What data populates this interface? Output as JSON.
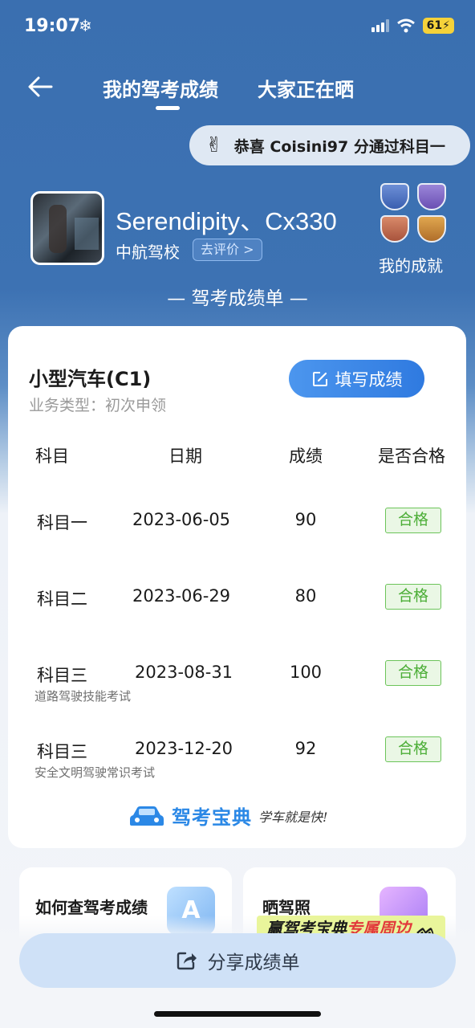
{
  "status_bar": {
    "time": "19:07",
    "battery": "61"
  },
  "nav": {
    "tab_mine": "我的驾考成绩",
    "tab_all": "大家正在晒"
  },
  "congrats": {
    "icon": "victory-hand-icon",
    "text": "恭喜 Coisini97 分通过科目一"
  },
  "profile": {
    "username": "Serendipity、Cx330",
    "school": "中航驾校",
    "review_label": "去评价 >",
    "achievements_label": "我的成就"
  },
  "sheet_title": "— 驾考成绩单 —",
  "card": {
    "vehicle": "小型汽车(C1)",
    "business_type": "业务类型：初次申领",
    "fill_label": "填写成绩",
    "headers": {
      "subject": "科目",
      "date": "日期",
      "score": "成绩",
      "pass": "是否合格"
    },
    "rows": [
      {
        "subject": "科目一",
        "date": "2023-06-05",
        "score": "90",
        "pass": "合格",
        "note": ""
      },
      {
        "subject": "科目二",
        "date": "2023-06-29",
        "score": "80",
        "pass": "合格",
        "note": ""
      },
      {
        "subject": "科目三",
        "date": "2023-08-31",
        "score": "100",
        "pass": "合格",
        "note": "道路驾驶技能考试"
      },
      {
        "subject": "科目三",
        "date": "2023-12-20",
        "score": "92",
        "pass": "合格",
        "note": "安全文明驾驶常识考试"
      }
    ],
    "brand_name": "驾考宝典",
    "brand_slogan": "学车就是快!"
  },
  "mini_cards": {
    "left_title": "如何查驾考成绩",
    "right_title": "晒驾照"
  },
  "peripheral": {
    "prefix": "赢驾考宝典",
    "highlight": "专属周边"
  },
  "share_label": "分享成绩单",
  "colors": {
    "accent": "#3a6fb0",
    "button": "#2f7ae0",
    "pass": "#4cae37"
  }
}
